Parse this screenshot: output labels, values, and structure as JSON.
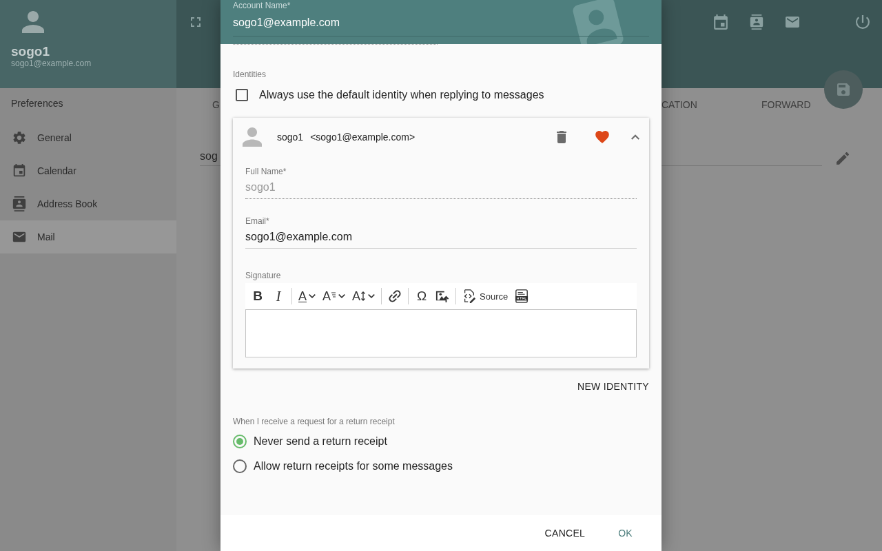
{
  "sidebar": {
    "user_name": "sogo1",
    "user_email": "sogo1@example.com",
    "heading": "Preferences",
    "items": [
      {
        "kind": "general",
        "label": "General",
        "selected": false
      },
      {
        "kind": "calendar",
        "label": "Calendar",
        "selected": false
      },
      {
        "kind": "address-book",
        "label": "Address Book",
        "selected": false
      },
      {
        "kind": "mail",
        "label": "Mail",
        "selected": true
      }
    ]
  },
  "tabs": [
    "G",
    "CATION",
    "FORWARD"
  ],
  "background_field": {
    "value": "sog"
  },
  "dialog": {
    "account_name": {
      "label": "Account Name*",
      "value": "sogo1@example.com"
    },
    "identities_label": "Identities",
    "default_identity_checkbox": {
      "label": "Always use the default identity when replying to messages",
      "checked": false
    },
    "identity": {
      "name": "sogo1",
      "email": "<sogo1@example.com>",
      "default": true,
      "expanded": true,
      "full_name": {
        "label": "Full Name*",
        "value": "sogo1",
        "disabled": true
      },
      "email_field": {
        "label": "Email*",
        "value": "sogo1@example.com"
      },
      "signature": {
        "label": "Signature",
        "toolbar": [
          {
            "kind": "bold",
            "text": "B"
          },
          {
            "kind": "italic",
            "text": "I"
          },
          {
            "kind": "separator"
          },
          {
            "kind": "font-color",
            "text": "A"
          },
          {
            "kind": "font-family",
            "text": "A"
          },
          {
            "kind": "font-size",
            "text": "A"
          },
          {
            "kind": "separator"
          },
          {
            "kind": "link"
          },
          {
            "kind": "separator"
          },
          {
            "kind": "special-char",
            "text": "Ω"
          },
          {
            "kind": "image"
          },
          {
            "kind": "separator"
          },
          {
            "kind": "source",
            "text": "Source"
          },
          {
            "kind": "html"
          }
        ]
      }
    },
    "new_identity_button": "NEW IDENTITY",
    "receipt": {
      "label": "When I receive a request for a return receipt",
      "options": [
        {
          "label": "Never send a return receipt",
          "selected": true
        },
        {
          "label": "Allow return receipts for some messages",
          "selected": false
        }
      ]
    },
    "buttons": [
      {
        "label": "CANCEL",
        "primary": false
      },
      {
        "label": "OK",
        "primary": true
      }
    ]
  }
}
